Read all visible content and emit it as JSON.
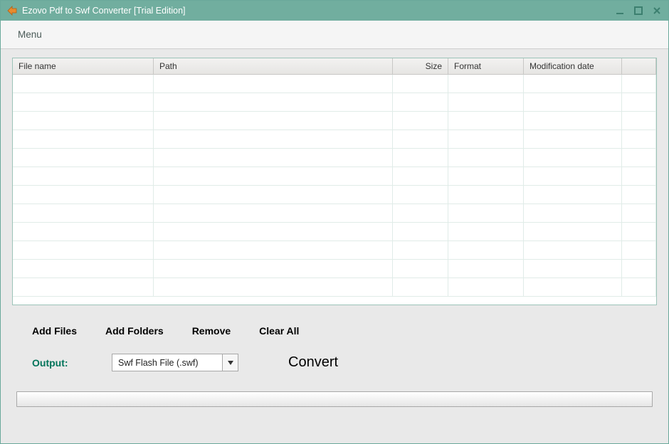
{
  "window": {
    "title": "Ezovo Pdf to Swf Converter [Trial Edition]"
  },
  "menubar": {
    "menu_label": "Menu"
  },
  "table": {
    "headers": {
      "file_name": "File name",
      "path": "Path",
      "size": "Size",
      "format": "Format",
      "modification_date": "Modification date"
    }
  },
  "actions": {
    "add_files": "Add Files",
    "add_folders": "Add Folders",
    "remove": "Remove",
    "clear_all": "Clear All"
  },
  "output": {
    "label": "Output:",
    "selected": "Swf Flash File (.swf)"
  },
  "convert_label": "Convert"
}
